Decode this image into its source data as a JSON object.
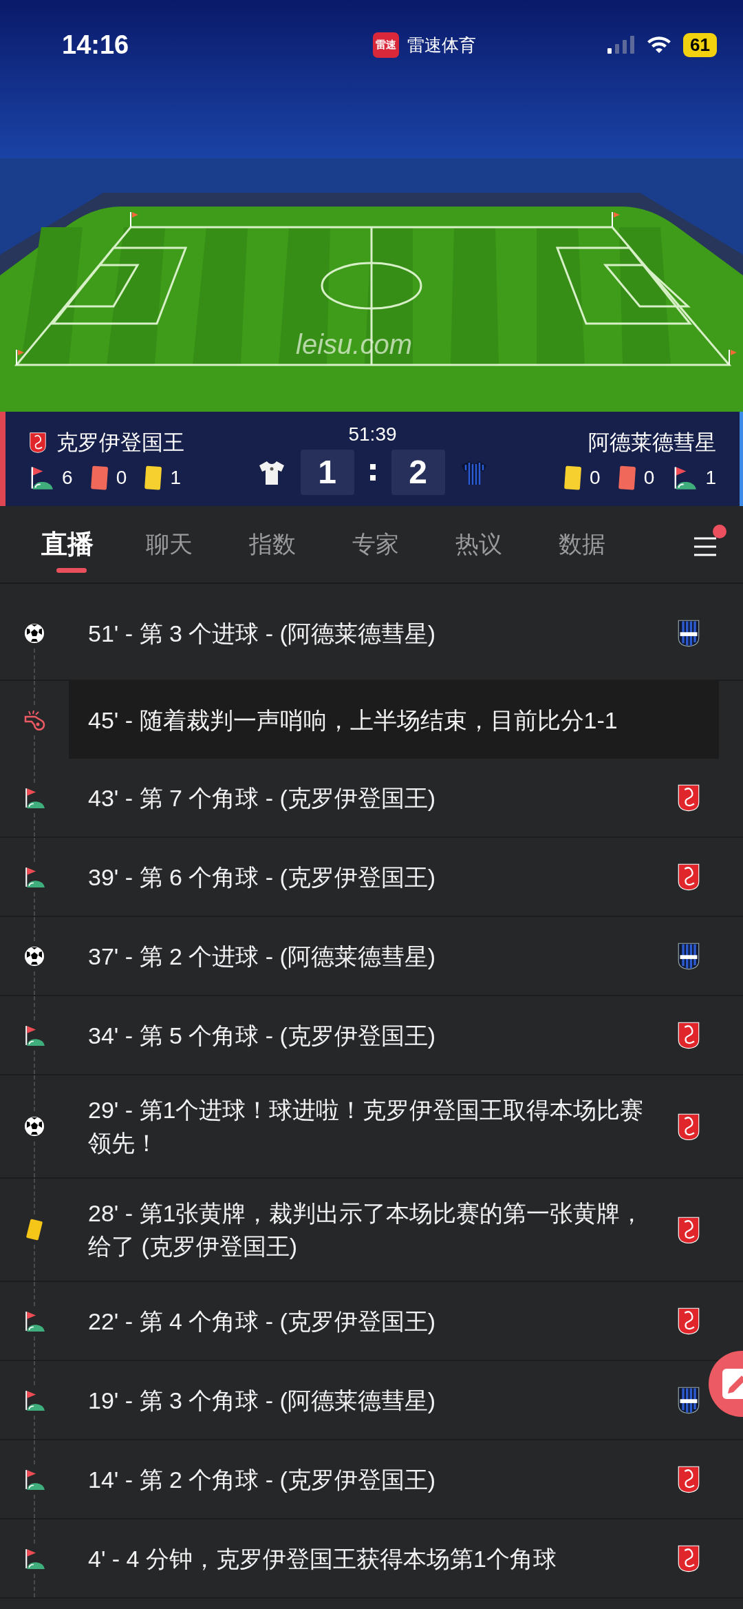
{
  "status_bar": {
    "time": "14:16",
    "app_icon_text": "雷速",
    "app_name": "雷速体育",
    "battery": "61"
  },
  "pitch": {
    "pitch_text": "leisu.com"
  },
  "scoreboard": {
    "match_time": "51:39",
    "home": {
      "name": "克罗伊登国王",
      "corners": "6",
      "red_cards": "0",
      "yellow_cards": "1",
      "score": "1"
    },
    "away": {
      "name": "阿德莱德彗星",
      "yellow_cards": "0",
      "red_cards": "0",
      "corners": "1",
      "score": "2"
    }
  },
  "tabs": [
    {
      "label": "直播",
      "selected": true
    },
    {
      "label": "聊天",
      "selected": false
    },
    {
      "label": "指数",
      "selected": false
    },
    {
      "label": "专家",
      "selected": false
    },
    {
      "label": "热议",
      "selected": false
    },
    {
      "label": "数据",
      "selected": false
    }
  ],
  "menu": {
    "notification": true
  },
  "events": [
    {
      "kind": "goal",
      "text": "51' - 第 3 个进球 - (阿德莱德彗星)",
      "badge": {
        "kind": "away"
      },
      "highlighted": false
    },
    {
      "kind": "whistle",
      "text": "45' - 随着裁判一声哨响，上半场结束，目前比分1-1",
      "highlighted": true
    },
    {
      "kind": "corner",
      "text": "43' - 第 7 个角球 - (克罗伊登国王)",
      "badge": {
        "kind": "home"
      },
      "highlighted": false
    },
    {
      "kind": "corner",
      "text": "39' - 第 6 个角球 - (克罗伊登国王)",
      "badge": {
        "kind": "home"
      },
      "highlighted": false
    },
    {
      "kind": "goal",
      "text": "37' - 第 2 个进球 - (阿德莱德彗星)",
      "badge": {
        "kind": "away"
      },
      "highlighted": false
    },
    {
      "kind": "corner",
      "text": "34' - 第 5 个角球 - (克罗伊登国王)",
      "badge": {
        "kind": "home"
      },
      "highlighted": false
    },
    {
      "kind": "goal",
      "text": "29' - 第1个进球！球进啦！克罗伊登国王取得本场比赛领先！",
      "badge": {
        "kind": "home"
      },
      "highlighted": false
    },
    {
      "kind": "yellow_card",
      "text": "28' - 第1张黄牌，裁判出示了本场比赛的第一张黄牌，给了 (克罗伊登国王)",
      "badge": {
        "kind": "home"
      },
      "highlighted": false
    },
    {
      "kind": "corner",
      "text": "22' - 第 4 个角球 - (克罗伊登国王)",
      "badge": {
        "kind": "home"
      },
      "highlighted": false
    },
    {
      "kind": "corner",
      "text": "19' - 第 3 个角球 - (阿德莱德彗星)",
      "badge": {
        "kind": "away"
      },
      "highlighted": false
    },
    {
      "kind": "corner",
      "text": "14' - 第 2 个角球 - (克罗伊登国王)",
      "badge": {
        "kind": "home"
      },
      "highlighted": false
    },
    {
      "kind": "corner",
      "text": "4' - 4 分钟，克罗伊登国王获得本场第1个角球",
      "badge": {
        "kind": "home"
      },
      "highlighted": false
    }
  ]
}
